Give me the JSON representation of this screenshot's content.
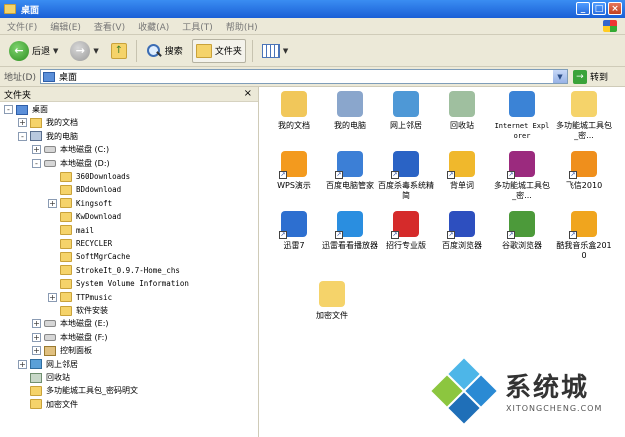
{
  "window": {
    "title": "桌面"
  },
  "menu": [
    "文件(F)",
    "编辑(E)",
    "查看(V)",
    "收藏(A)",
    "工具(T)",
    "帮助(H)"
  ],
  "toolbar": {
    "back_label": "后退",
    "search_label": "搜索",
    "folders_label": "文件夹"
  },
  "address": {
    "label": "地址(D)",
    "value": "桌面",
    "go_label": "转到"
  },
  "folderpane": {
    "title": "文件夹",
    "tree": [
      {
        "label": "桌面",
        "icon": "desktop-icon",
        "expander": "-"
      },
      {
        "label": "我的文档",
        "icon": "documents-icon",
        "expander": "+"
      },
      {
        "label": "我的电脑",
        "icon": "computer-icon",
        "expander": "-"
      },
      {
        "label": "本地磁盘 (C:)",
        "icon": "drive-icon",
        "expander": "+"
      },
      {
        "label": "本地磁盘 (D:)",
        "icon": "drive-icon",
        "expander": "-"
      },
      {
        "label": "360Downloads",
        "icon": "folder-icon",
        "expander": ""
      },
      {
        "label": "BDdownload",
        "icon": "folder-icon",
        "expander": ""
      },
      {
        "label": "Kingsoft",
        "icon": "folder-icon",
        "expander": "+"
      },
      {
        "label": "KwDownload",
        "icon": "folder-icon",
        "expander": ""
      },
      {
        "label": "mail",
        "icon": "folder-icon",
        "expander": ""
      },
      {
        "label": "RECYCLER",
        "icon": "folder-icon",
        "expander": ""
      },
      {
        "label": "SoftMgrCache",
        "icon": "folder-icon",
        "expander": ""
      },
      {
        "label": "StrokeIt_0.9.7-Home_chs",
        "icon": "folder-icon",
        "expander": ""
      },
      {
        "label": "System Volume Information",
        "icon": "folder-icon",
        "expander": ""
      },
      {
        "label": "TTPmusic",
        "icon": "folder-icon",
        "expander": "+"
      },
      {
        "label": "软件安装",
        "icon": "folder-icon",
        "expander": ""
      },
      {
        "label": "本地磁盘 (E:)",
        "icon": "drive-icon",
        "expander": "+"
      },
      {
        "label": "本地磁盘 (F:)",
        "icon": "drive-icon",
        "expander": "+"
      },
      {
        "label": "控制面板",
        "icon": "control-panel-icon",
        "expander": "+"
      },
      {
        "label": "网上邻居",
        "icon": "network-icon",
        "expander": "+"
      },
      {
        "label": "回收站",
        "icon": "recycle-bin-icon",
        "expander": ""
      },
      {
        "label": "多功能城工具包_密码明文",
        "icon": "folder-icon",
        "expander": ""
      },
      {
        "label": "加密文件",
        "icon": "folder-icon",
        "expander": ""
      }
    ]
  },
  "desktop_items": [
    {
      "label": "我的文档",
      "icon": "documents-icon",
      "color": "#f1c75a",
      "shortcut": false
    },
    {
      "label": "我的电脑",
      "icon": "computer-icon",
      "color": "#8aa6cc",
      "shortcut": false
    },
    {
      "label": "网上邻居",
      "icon": "network-icon",
      "color": "#4e98d6",
      "shortcut": false
    },
    {
      "label": "回收站",
      "icon": "recycle-bin-icon",
      "color": "#9fbf9f",
      "shortcut": false
    },
    {
      "label": "Internet Explorer",
      "icon": "ie-icon",
      "color": "#3b83d6",
      "shortcut": false
    },
    {
      "label": "多功能城工具包_密...",
      "icon": "folder-icon",
      "color": "#f5d36a",
      "shortcut": false
    },
    {
      "label": "WPS演示",
      "icon": "wps-icon",
      "color": "#f39a1e",
      "shortcut": true
    },
    {
      "label": "百度电脑管家",
      "icon": "baidu-manager-icon",
      "color": "#3c7fd6",
      "shortcut": true
    },
    {
      "label": "百度杀毒系统精简",
      "icon": "baidu-antivirus-icon",
      "color": "#2a63c5",
      "shortcut": true
    },
    {
      "label": "背单词",
      "icon": "vocab-icon",
      "color": "#f0b82c",
      "shortcut": true
    },
    {
      "label": "多功能城工具包_密...",
      "icon": "winrar-icon",
      "color": "#9b2a7e",
      "shortcut": true
    },
    {
      "label": "飞信2010",
      "icon": "fetion-icon",
      "color": "#ef8f1c",
      "shortcut": true
    },
    {
      "label": "迅雷7",
      "icon": "xunlei-icon",
      "color": "#2d6fd0",
      "shortcut": true
    },
    {
      "label": "迅雷看看播放器",
      "icon": "xunlei-player-icon",
      "color": "#2a8ee0",
      "shortcut": true
    },
    {
      "label": "招行专业版",
      "icon": "cmb-icon",
      "color": "#d52b2b",
      "shortcut": true
    },
    {
      "label": "百度浏览器",
      "icon": "baidu-browser-icon",
      "color": "#2d4fbf",
      "shortcut": true
    },
    {
      "label": "谷歌浏览器",
      "icon": "chrome-icon",
      "color": "#4c9a3a",
      "shortcut": true
    },
    {
      "label": "酷我音乐盒2010",
      "icon": "kuwo-icon",
      "color": "#f0a51e",
      "shortcut": true
    },
    {
      "label": "加密文件",
      "icon": "folder-icon",
      "color": "#f5d36a",
      "shortcut": false
    }
  ],
  "watermark": {
    "text": "系统城",
    "subtext": "XITONGCHENG.COM"
  }
}
